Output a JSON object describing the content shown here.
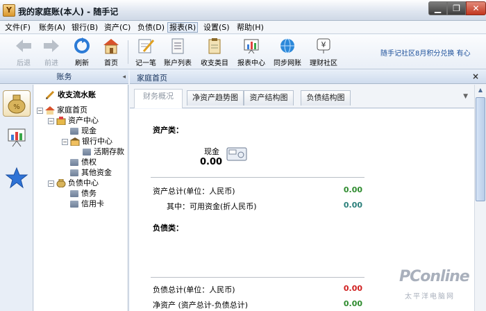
{
  "window": {
    "title": "我的家庭账(本人) - 随手记",
    "app_icon": "Y",
    "controls": {
      "minimize": "▁",
      "maximize": "❐",
      "close": "✕"
    }
  },
  "menu": [
    {
      "label": "文件(F)"
    },
    {
      "label": "账务(A)"
    },
    {
      "label": "银行(B)"
    },
    {
      "label": "资产(C)"
    },
    {
      "label": "负债(D)"
    },
    {
      "label": "报表(R)",
      "active": true
    },
    {
      "label": "设置(S)"
    },
    {
      "label": "帮助(H)"
    }
  ],
  "toolbar": {
    "buttons": [
      {
        "label": "后退",
        "icon": "back-arrow-icon",
        "enabled": false
      },
      {
        "label": "前进",
        "icon": "forward-arrow-icon",
        "enabled": false
      },
      {
        "label": "刷新",
        "icon": "refresh-icon",
        "enabled": true
      },
      {
        "label": "首页",
        "icon": "home-icon",
        "enabled": true
      },
      {
        "label": "记一笔",
        "icon": "notepad-pencil-icon",
        "enabled": true
      },
      {
        "label": "账户列表",
        "icon": "account-list-icon",
        "enabled": true
      },
      {
        "label": "收支类目",
        "icon": "clipboard-icon",
        "enabled": true
      },
      {
        "label": "报表中心",
        "icon": "report-chart-icon",
        "enabled": true
      },
      {
        "label": "同步网账",
        "icon": "sync-globe-icon",
        "enabled": true
      },
      {
        "label": "理财社区",
        "icon": "yuan-community-icon",
        "enabled": true
      }
    ],
    "links": "随手记社区8月积分兑换 有心"
  },
  "left_panel": {
    "header": "账务",
    "collapse_arrow": "◂",
    "tree_title": "收支流水账",
    "tree": [
      {
        "label": "家庭首页",
        "level": 0,
        "expander": "−",
        "icon": "house-icon"
      },
      {
        "label": "资产中心",
        "level": 1,
        "expander": "−",
        "icon": "asset-center-icon"
      },
      {
        "label": "现金",
        "level": 2,
        "icon": "folder-icon"
      },
      {
        "label": "银行中心",
        "level": 2,
        "expander": "−",
        "icon": "bank-icon"
      },
      {
        "label": "活期存款",
        "level": 3,
        "icon": "folder-icon"
      },
      {
        "label": "债权",
        "level": 2,
        "icon": "folder-icon"
      },
      {
        "label": "其他资金",
        "level": 2,
        "icon": "folder-icon"
      },
      {
        "label": "负债中心",
        "level": 1,
        "expander": "−",
        "icon": "liability-center-icon"
      },
      {
        "label": "债务",
        "level": 2,
        "icon": "folder-icon"
      },
      {
        "label": "信用卡",
        "level": 2,
        "icon": "folder-icon"
      }
    ]
  },
  "main": {
    "header": "家庭首页",
    "close": "×",
    "tabs": [
      {
        "label": "财务概况",
        "active": true
      },
      {
        "label": "净资产趋势图"
      },
      {
        "label": "资产结构图"
      },
      {
        "label": "负债结构图"
      }
    ],
    "tab_menu": "▼",
    "assets": {
      "section": "资产类：",
      "cash_label": "现金",
      "cash_value": "0.00",
      "total_label": "资产总计(单位：人民币)",
      "total_value": "0.00",
      "available_label": "其中：可用资金(折人民币)",
      "available_value": "0.00"
    },
    "liabilities": {
      "section": "负债类：",
      "total_label": "负债总计(单位：人民币)",
      "total_value": "0.00",
      "net_label": "净资产 (资产总计-负债总计)",
      "net_value": "0.00"
    }
  },
  "watermark": {
    "main": "PConline",
    "sub": "太平洋电脑网"
  },
  "colors": {
    "positive_value": "#2e8b2e",
    "available_value": "#2a7f7a",
    "negative_value": "#d02020",
    "link": "#1b4f9a",
    "header_bg": "#dfe8f4"
  }
}
